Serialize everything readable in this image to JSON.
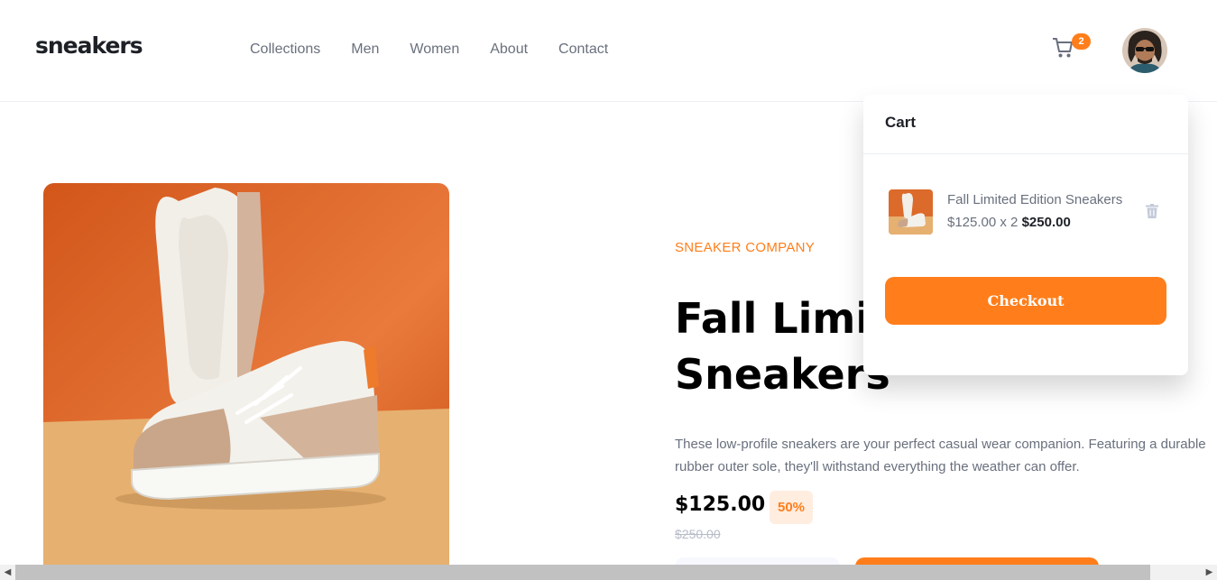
{
  "header": {
    "logo": "sneakers",
    "nav": [
      "Collections",
      "Men",
      "Women",
      "About",
      "Contact"
    ],
    "cart_count": "2"
  },
  "product": {
    "company": "SNEAKER COMPANY",
    "title_line1": "Fall Limited Edition",
    "title_line2": "Sneakers",
    "description": "These low-profile sneakers are your perfect casual wear companion. Featuring a durable rubber outer sole, they'll withstand everything the weather can offer.",
    "price": "$125.00",
    "discount": "50%",
    "old_price": "$250.00"
  },
  "cart": {
    "title": "Cart",
    "item": {
      "name": "Fall Limited Edition Sneakers",
      "unit_calc": "$125.00 x 2",
      "total": "$250.00"
    },
    "checkout_label": "Checkout"
  },
  "colors": {
    "accent": "#ff7e1b",
    "accent_pale": "#ffede0",
    "text_dark": "#1d2026",
    "text_gray": "#69707d"
  },
  "icons": {
    "cart": "cart-icon",
    "trash": "trash-icon",
    "scroll_left": "◀",
    "scroll_right": "▶"
  }
}
